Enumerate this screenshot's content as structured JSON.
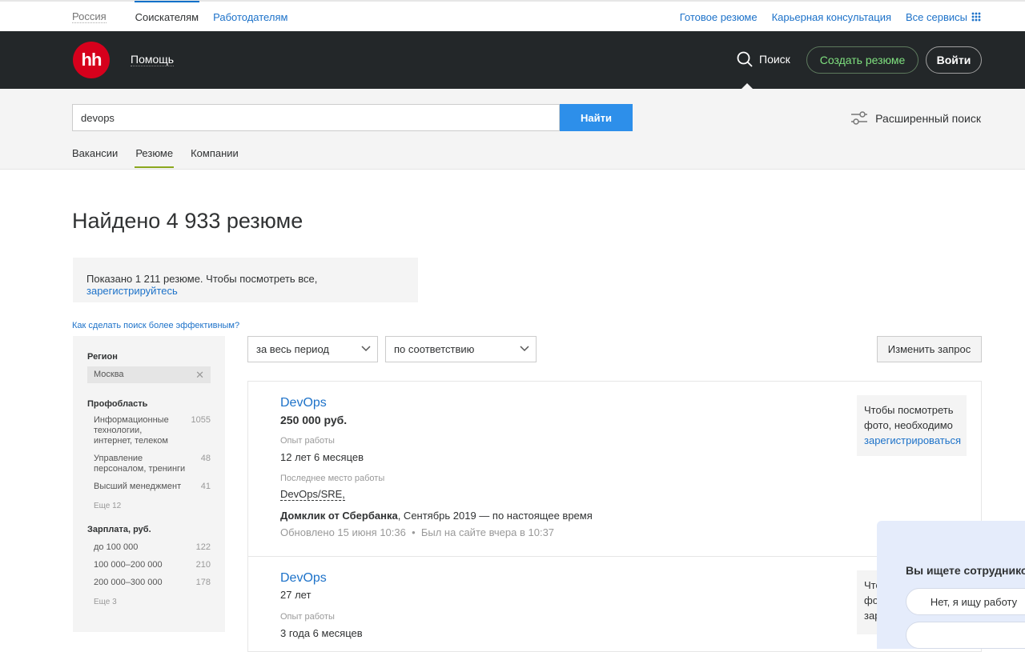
{
  "topbar": {
    "region": "Россия",
    "seekers": "Соискателям",
    "employers": "Работодателям",
    "ready_resume": "Готовое резюме",
    "career": "Карьерная консультация",
    "all_services": "Все сервисы"
  },
  "header": {
    "logo": "hh",
    "help": "Помощь",
    "search": "Поиск",
    "create_resume": "Создать резюме",
    "login": "Войти"
  },
  "search": {
    "query": "devops",
    "button": "Найти",
    "advanced": "Расширенный поиск",
    "tabs": [
      {
        "label": "Вакансии"
      },
      {
        "label": "Резюме"
      },
      {
        "label": "Компании"
      }
    ]
  },
  "main": {
    "title": "Найдено 4 933 резюме",
    "notice_text": "Показано 1 211 резюме. Чтобы посмотреть все, ",
    "notice_link": "зарегистрируйтесь",
    "tip": "Как сделать поиск более эффективным?"
  },
  "sidebar": {
    "region_title": "Регион",
    "region_value": "Москва",
    "prof_title": "Профобласть",
    "prof_items": [
      {
        "label": "Информационные технологии, интернет, телеком",
        "count": "1055"
      },
      {
        "label": "Управление персоналом, тренинги",
        "count": "48"
      },
      {
        "label": "Высший менеджмент",
        "count": "41"
      }
    ],
    "prof_more": "Еще 12",
    "salary_title": "Зарплата, руб.",
    "salary_items": [
      {
        "label": "до 100 000",
        "count": "122"
      },
      {
        "label": "100 000–200 000",
        "count": "210"
      },
      {
        "label": "200 000–300 000",
        "count": "178"
      }
    ],
    "salary_more": "Еще 3"
  },
  "controls": {
    "period": "за весь период",
    "sort": "по соответствию",
    "change": "Изменить запрос"
  },
  "results": [
    {
      "title": "DevOps",
      "subtitle": "250 000 руб.",
      "exp_label": "Опыт работы",
      "exp_value": "12 лет 6 месяцев",
      "last_label": "Последнее место работы",
      "position": "DevOps/SRE,",
      "company": "Домклик от Сбербанка",
      "period": ", Сентябрь 2019 — по настоящее время",
      "updated": "Обновлено 15 июня 10:36  •  Был на сайте вчера в 10:37",
      "photo_text": "Чтобы посмотреть фото, необходимо ",
      "photo_link": "зарегистрироваться"
    },
    {
      "title": "DevOps",
      "subtitle": "27 лет",
      "exp_label": "Опыт работы",
      "exp_value": "3 года 6 месяцев",
      "photo_text": "Что фо зар"
    }
  ],
  "popup": {
    "question": "Вы ищете сотрудников",
    "option_no": "Нет, я ищу работу"
  },
  "colors": {
    "accent": "#1d72c9",
    "brand_red": "#d6001c",
    "header_bg": "#232729",
    "search_button": "#2d8fea",
    "tab_underline": "#8ba71d"
  }
}
